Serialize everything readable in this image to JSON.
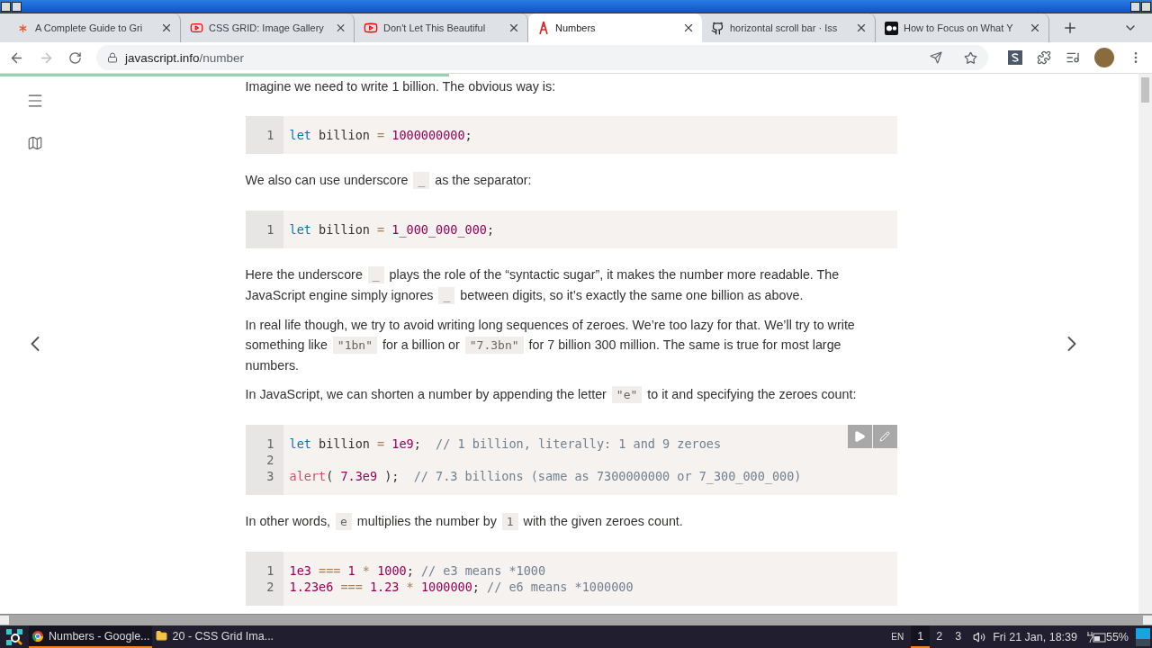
{
  "tabs": [
    {
      "title": "A Complete Guide to Gri",
      "selected": false
    },
    {
      "title": "CSS GRID: Image Gallery",
      "selected": false
    },
    {
      "title": "Don't Let This Beautiful",
      "selected": false
    },
    {
      "title": "Numbers",
      "selected": true
    },
    {
      "title": "horizontal scroll bar · Iss",
      "selected": false
    },
    {
      "title": "How to Focus on What Y",
      "selected": false
    }
  ],
  "address": {
    "host": "javascript.info",
    "path": "/number"
  },
  "page": {
    "reading_progress": {
      "level": 0.39
    },
    "blocks": [
      {
        "kind": "paragraph",
        "parts": [
          {
            "text": "Imagine we need to write 1 billion. The obvious way is:"
          }
        ]
      },
      {
        "kind": "code",
        "runnable": false,
        "lines": [
          {
            "number": "1",
            "text": "let billion = 1000000000;"
          }
        ]
      },
      {
        "kind": "paragraph",
        "parts": [
          {
            "text": "We also can use underscore "
          },
          {
            "code": "_"
          },
          {
            "text": " as the separator:"
          }
        ]
      },
      {
        "kind": "code",
        "runnable": false,
        "lines": [
          {
            "number": "1",
            "text": "let billion = 1_000_000_000;"
          }
        ]
      },
      {
        "kind": "paragraph",
        "parts": [
          {
            "text": "Here the underscore "
          },
          {
            "code": "_"
          },
          {
            "text": " plays the role of the “syntactic sugar”, it makes the number more readable. The JavaScript engine simply ignores "
          },
          {
            "code": "_"
          },
          {
            "text": " between digits, so it’s exactly the same one billion as above."
          }
        ]
      },
      {
        "kind": "paragraph",
        "parts": [
          {
            "text": "In real life though, we try to avoid writing long sequences of zeroes. We’re too lazy for that. We’ll try to write something like "
          },
          {
            "code": "\"1bn\""
          },
          {
            "text": " for a billion or "
          },
          {
            "code": "\"7.3bn\""
          },
          {
            "text": " for 7 billion 300 million. The same is true for most large numbers."
          }
        ]
      },
      {
        "kind": "paragraph",
        "parts": [
          {
            "text": "In JavaScript, we can shorten a number by appending the letter "
          },
          {
            "code": "\"e\""
          },
          {
            "text": " to it and specifying the zeroes count:"
          }
        ]
      },
      {
        "kind": "code",
        "runnable": true,
        "lines": [
          {
            "number": "1",
            "text": "let billion = 1e9;  // 1 billion, literally: 1 and 9 zeroes"
          },
          {
            "number": "2"
          },
          {
            "number": "3",
            "text": "alert( 7.3e9 );  // 7.3 billions (same as 7300000000 or 7_300_000_000)"
          }
        ]
      },
      {
        "kind": "paragraph",
        "parts": [
          {
            "text": "In other words, "
          },
          {
            "code": "e"
          },
          {
            "text": " multiplies the number by "
          },
          {
            "code": "1"
          },
          {
            "text": " with the given zeroes count."
          }
        ]
      },
      {
        "kind": "code",
        "runnable": false,
        "lines": [
          {
            "number": "1",
            "text": "1e3 === 1 * 1000; // e3 means *1000"
          },
          {
            "number": "2",
            "text": "1.23e6 === 1.23 * 1000000; // e6 means *1000000"
          }
        ]
      }
    ]
  },
  "taskbar": {
    "windows": [
      {
        "label": "Numbers - Google...",
        "selected": true
      },
      {
        "label": "20 - CSS Grid Ima...",
        "selected": false
      }
    ],
    "language": "EN",
    "workspaces": [
      {
        "label": "1",
        "selected": true
      },
      {
        "label": "2",
        "selected": false
      },
      {
        "label": "3",
        "selected": false
      }
    ],
    "clock": "Fri 21 Jan, 18:39",
    "battery": "55%"
  }
}
